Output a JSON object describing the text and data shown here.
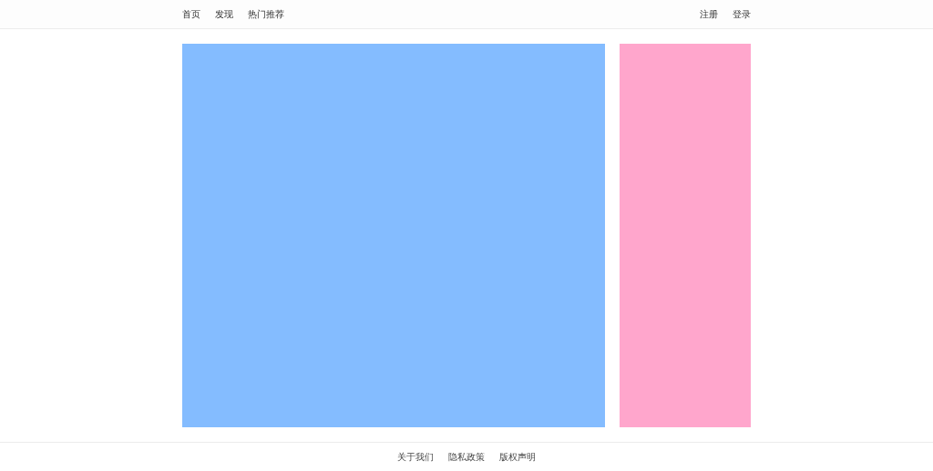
{
  "nav": {
    "left": [
      {
        "label": "首页"
      },
      {
        "label": "发现"
      },
      {
        "label": "热门推荐"
      }
    ],
    "right": [
      {
        "label": "注册"
      },
      {
        "label": "登录"
      }
    ]
  },
  "footer": {
    "links": [
      {
        "label": "关于我们"
      },
      {
        "label": "隐私政策"
      },
      {
        "label": "版权声明"
      }
    ]
  }
}
